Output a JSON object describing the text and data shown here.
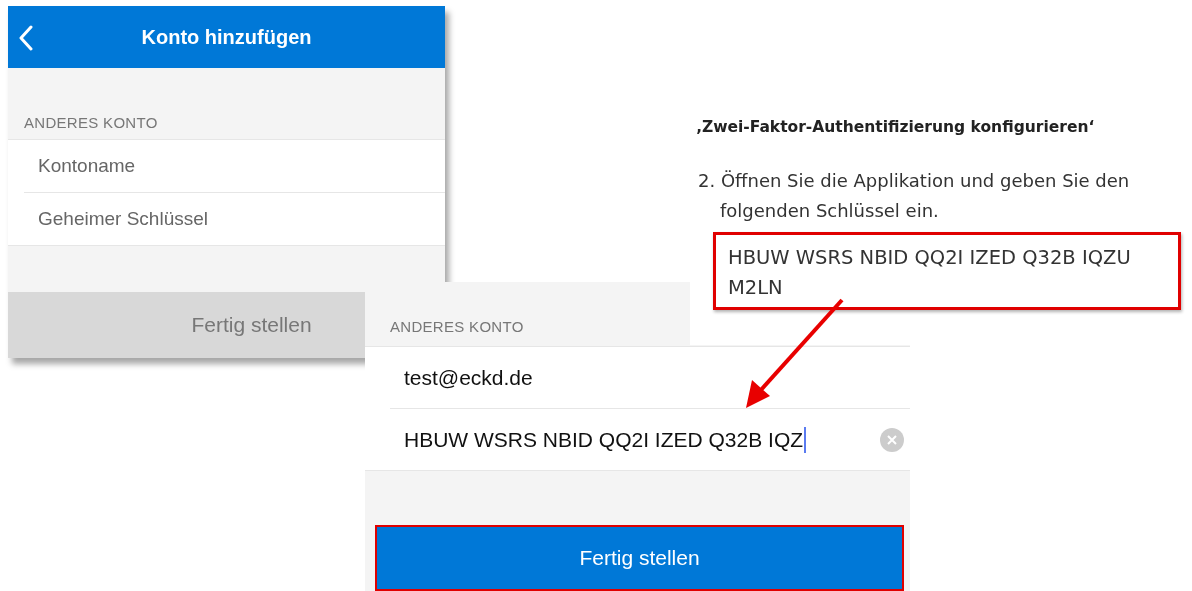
{
  "back_panel": {
    "title": "Konto hinzufügen",
    "section_label": "ANDERES KONTO",
    "fields": [
      {
        "placeholder": "Kontoname"
      },
      {
        "placeholder": "Geheimer Schlüssel"
      }
    ],
    "button": {
      "label": "Fertig stellen",
      "disabled": true
    }
  },
  "instructions": {
    "heading": "‚Zwei-Faktor-Authentifizierung konfigurieren‘",
    "step_number": "2.",
    "step": "Öffnen Sie die Applikation und geben Sie den folgenden Schlüssel ein.",
    "key": "HBUW WSRS NBID QQ2I IZED Q32B IQZU M2LN",
    "highlighted": true
  },
  "front_panel": {
    "section_label": "ANDERES KONTO",
    "fields": [
      {
        "value": "test@eckd.de",
        "focused": false
      },
      {
        "value": "HBUW WSRS NBID QQ2I IZED Q32B IQZ",
        "focused": true
      }
    ],
    "button": {
      "label": "Fertig stellen",
      "disabled": false,
      "highlighted": true
    }
  }
}
